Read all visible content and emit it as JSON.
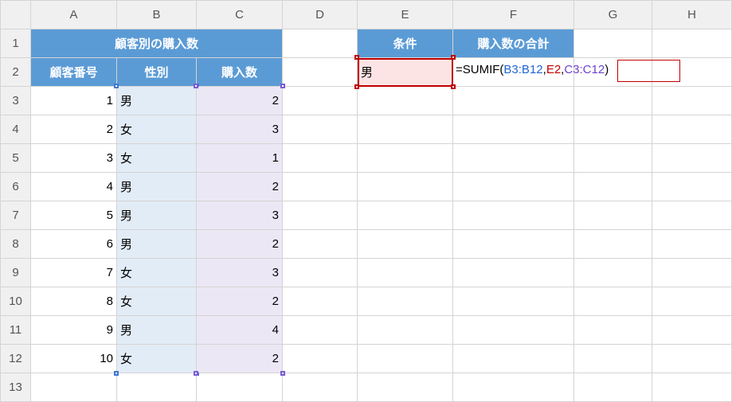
{
  "columns": [
    "A",
    "B",
    "C",
    "D",
    "E",
    "F",
    "G",
    "H"
  ],
  "rows": [
    "1",
    "2",
    "3",
    "4",
    "5",
    "6",
    "7",
    "8",
    "9",
    "10",
    "11",
    "12",
    "13"
  ],
  "headers": {
    "merged_title": "顧客別の購入数",
    "colA": "顧客番号",
    "colB": "性別",
    "colC": "購入数",
    "colE": "条件",
    "colF": "購入数の合計"
  },
  "table": [
    {
      "id": "1",
      "gender": "男",
      "qty": "2"
    },
    {
      "id": "2",
      "gender": "女",
      "qty": "3"
    },
    {
      "id": "3",
      "gender": "女",
      "qty": "1"
    },
    {
      "id": "4",
      "gender": "男",
      "qty": "2"
    },
    {
      "id": "5",
      "gender": "男",
      "qty": "3"
    },
    {
      "id": "6",
      "gender": "男",
      "qty": "2"
    },
    {
      "id": "7",
      "gender": "女",
      "qty": "3"
    },
    {
      "id": "8",
      "gender": "女",
      "qty": "2"
    },
    {
      "id": "9",
      "gender": "男",
      "qty": "4"
    },
    {
      "id": "10",
      "gender": "女",
      "qty": "2"
    }
  ],
  "criteria": {
    "E2": "男"
  },
  "formula": {
    "prefix": "=SUMIF(",
    "arg1": "B3:B12",
    "sep1": ",",
    "arg2": "E2",
    "sep2": ",",
    "arg3": "C3:C12",
    "suffix": ")"
  }
}
